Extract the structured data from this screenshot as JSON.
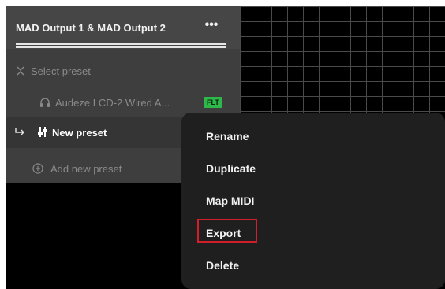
{
  "panel": {
    "title": "MAD Output 1 & MAD Output 2",
    "more_label": "•••",
    "select_preset": "Select preset",
    "presets": [
      {
        "label": "Audeze LCD-2 Wired A...",
        "badge": "FLT"
      },
      {
        "label": "New preset"
      }
    ],
    "add_preset": "Add new preset"
  },
  "context_menu": {
    "items": [
      "Rename",
      "Duplicate",
      "Map MIDI",
      "Export",
      "Delete"
    ],
    "highlighted": "Export"
  },
  "colors": {
    "badge_green": "#2fb84a",
    "highlight_red": "#d01f2b"
  }
}
